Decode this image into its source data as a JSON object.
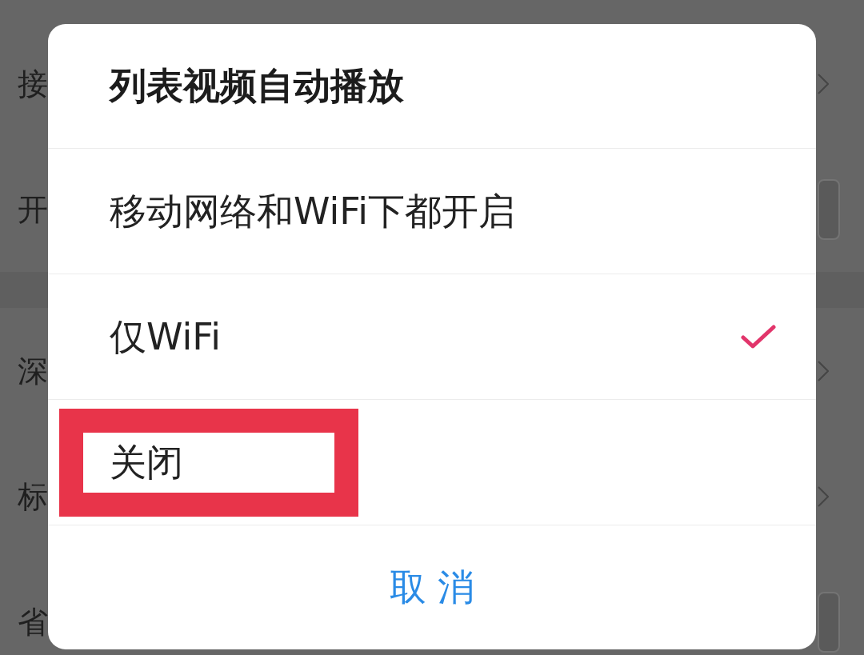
{
  "background": {
    "sections": [
      {
        "rows": [
          {
            "label": "接",
            "kind": "chevron"
          },
          {
            "label": "开",
            "kind": "toggle",
            "on": false
          }
        ]
      },
      {
        "rows": [
          {
            "label": "深",
            "kind": "chevron"
          },
          {
            "label": "标",
            "kind": "chevron"
          },
          {
            "label": "省",
            "kind": "toggle",
            "on": false
          }
        ]
      }
    ]
  },
  "dialog": {
    "title": "列表视频自动播放",
    "options": [
      {
        "label": "移动网络和WiFi下都开启",
        "selected": false,
        "highlighted": false
      },
      {
        "label": "仅WiFi",
        "selected": true,
        "highlighted": false
      },
      {
        "label": "关闭",
        "selected": false,
        "highlighted": true
      }
    ],
    "cancel_button": "取 消"
  }
}
